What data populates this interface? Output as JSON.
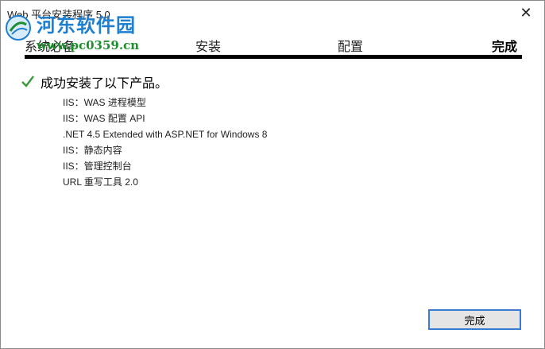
{
  "window": {
    "title": "Web 平台安装程序 5.0",
    "close_glyph": "✕"
  },
  "watermark": {
    "site_name": "河东软件园",
    "url": "www.pc0359.cn"
  },
  "steps": [
    "系统必备",
    "安装",
    "配置",
    "完成"
  ],
  "active_step": "完成",
  "progress": {
    "complete_percent": 100
  },
  "result": {
    "message": "成功安装了以下产品。",
    "icon": "check-icon",
    "icon_color": "#3a9b3a"
  },
  "products": [
    "IIS：WAS 进程模型",
    "IIS：WAS 配置 API",
    ".NET 4.5 Extended with ASP.NET for Windows 8",
    "IIS：静态内容",
    "IIS：管理控制台",
    "URL 重写工具 2.0"
  ],
  "buttons": {
    "finish": "完成"
  },
  "colors": {
    "accent": "#3b7ad4",
    "watermark_name": "#1e7fd0",
    "watermark_url": "#1e8f2e"
  }
}
